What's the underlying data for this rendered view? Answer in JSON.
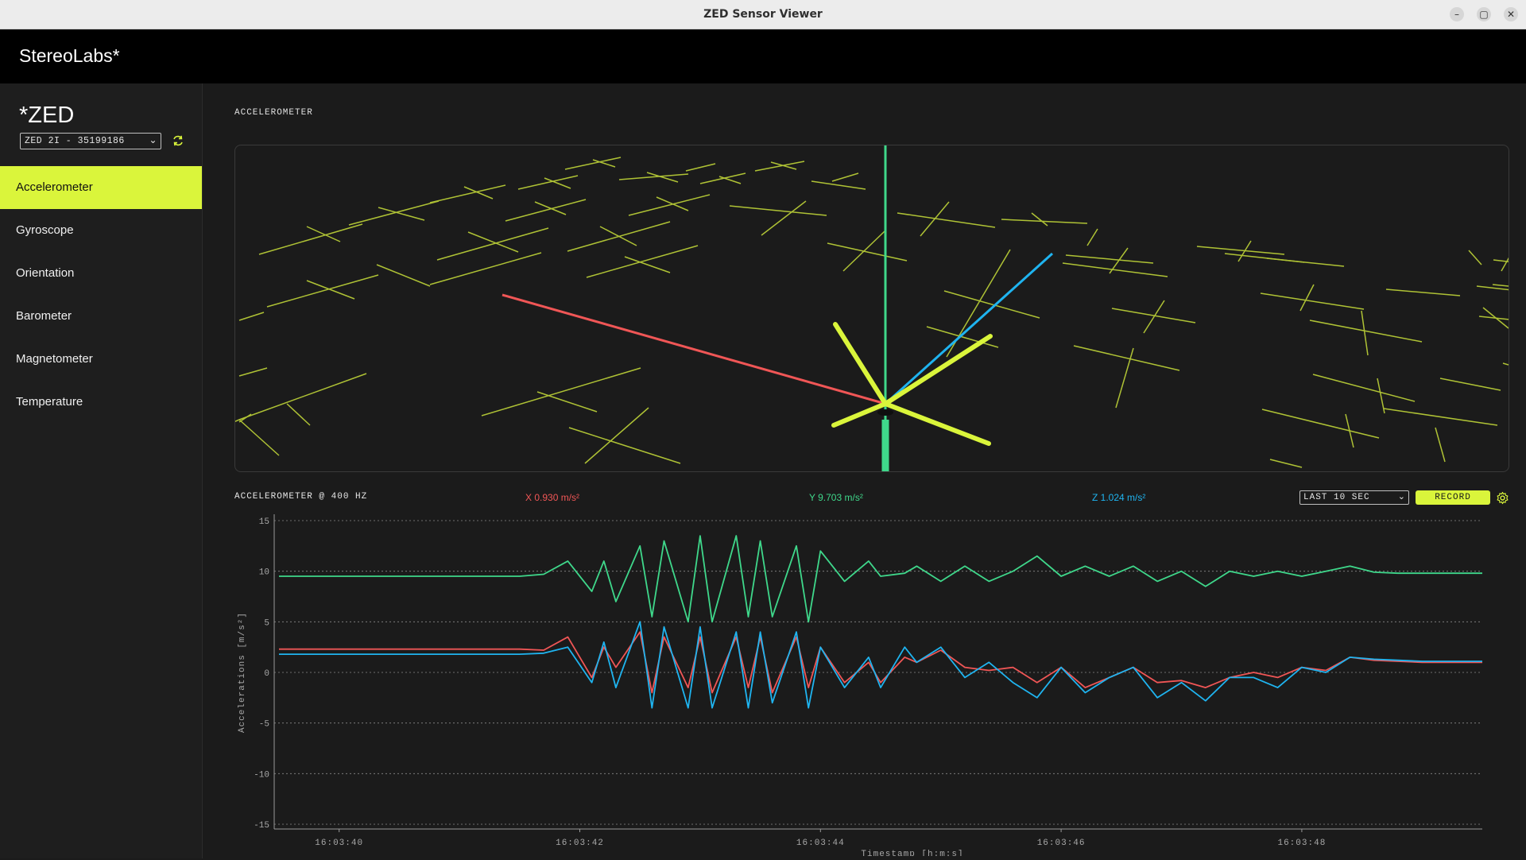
{
  "window": {
    "title": "ZED Sensor Viewer",
    "controls": [
      "–",
      "▢",
      "✕"
    ]
  },
  "app": {
    "brand": "StereoLabs*"
  },
  "sidebar": {
    "title": "*ZED",
    "device": "ZED 2I - 35199186",
    "items": [
      {
        "label": "Accelerometer",
        "active": true
      },
      {
        "label": "Gyroscope"
      },
      {
        "label": "Orientation"
      },
      {
        "label": "Barometer"
      },
      {
        "label": "Magnetometer"
      },
      {
        "label": "Temperature"
      }
    ]
  },
  "main": {
    "section_label": "ACCELEROMETER",
    "chart_header": {
      "title": "ACCELEROMETER @  400 HZ",
      "x_readout": "X 0.930 m/s²",
      "y_readout": "Y 9.703 m/s²",
      "z_readout": "Z 1.024 m/s²",
      "range": "LAST 10 SEC",
      "record": "RECORD"
    }
  },
  "colors": {
    "accent": "#daf53b",
    "x": "#f05656",
    "y": "#3fd88b",
    "z": "#1fb4f0"
  },
  "chart_data": {
    "type": "line",
    "xlabel": "Timestamp [h:m:s]",
    "ylabel": "Accelerations [m/s²]",
    "ylim": [
      -15,
      15
    ],
    "yticks": [
      15,
      10,
      5,
      0,
      -5,
      -10,
      -15
    ],
    "xlim": [
      "16:03:39.5",
      "16:03:49.5"
    ],
    "xticks": [
      "16:03:40",
      "16:03:42",
      "16:03:44",
      "16:03:46",
      "16:03:48"
    ],
    "grid": true,
    "x": [
      "16:03:39.5",
      "16:03:40.0",
      "16:03:40.5",
      "16:03:41.0",
      "16:03:41.5",
      "16:03:41.7",
      "16:03:41.9",
      "16:03:42.1",
      "16:03:42.2",
      "16:03:42.3",
      "16:03:42.5",
      "16:03:42.6",
      "16:03:42.7",
      "16:03:42.9",
      "16:03:43.0",
      "16:03:43.1",
      "16:03:43.3",
      "16:03:43.4",
      "16:03:43.5",
      "16:03:43.6",
      "16:03:43.8",
      "16:03:43.9",
      "16:03:44.0",
      "16:03:44.2",
      "16:03:44.4",
      "16:03:44.5",
      "16:03:44.7",
      "16:03:44.8",
      "16:03:45.0",
      "16:03:45.2",
      "16:03:45.4",
      "16:03:45.6",
      "16:03:45.8",
      "16:03:46.0",
      "16:03:46.2",
      "16:03:46.4",
      "16:03:46.6",
      "16:03:46.8",
      "16:03:47.0",
      "16:03:47.2",
      "16:03:47.4",
      "16:03:47.6",
      "16:03:47.8",
      "16:03:48.0",
      "16:03:48.2",
      "16:03:48.4",
      "16:03:48.6",
      "16:03:48.8",
      "16:03:49.0",
      "16:03:49.5"
    ],
    "series": [
      {
        "name": "X",
        "values": [
          2.3,
          2.3,
          2.3,
          2.3,
          2.3,
          2.2,
          3.5,
          -0.5,
          2.5,
          0.5,
          4.0,
          -2.0,
          3.5,
          -1.5,
          3.5,
          -2.0,
          3.5,
          -1.5,
          3.5,
          -2.0,
          3.5,
          -1.5,
          2.5,
          -1.0,
          1.0,
          -1.0,
          1.5,
          1.0,
          2.2,
          0.5,
          0.2,
          0.5,
          -1.0,
          0.5,
          -1.5,
          -0.5,
          0.5,
          -1.0,
          -0.8,
          -1.5,
          -0.5,
          0.0,
          -0.5,
          0.5,
          0.2,
          1.5,
          1.2,
          1.1,
          1.0,
          1.0
        ]
      },
      {
        "name": "Y",
        "values": [
          9.5,
          9.5,
          9.5,
          9.5,
          9.5,
          9.7,
          11.0,
          8.0,
          11.0,
          7.0,
          12.5,
          5.5,
          13.0,
          5.0,
          13.5,
          5.0,
          13.5,
          5.5,
          13.0,
          5.5,
          12.5,
          5.0,
          12.0,
          9.0,
          11.0,
          9.5,
          9.8,
          10.5,
          9.0,
          10.5,
          9.0,
          10.0,
          11.5,
          9.5,
          10.5,
          9.5,
          10.5,
          9.0,
          10.0,
          8.5,
          10.0,
          9.5,
          10.0,
          9.5,
          10.0,
          10.5,
          9.9,
          9.8,
          9.8,
          9.8
        ]
      },
      {
        "name": "Z",
        "values": [
          1.8,
          1.8,
          1.8,
          1.8,
          1.8,
          1.9,
          2.5,
          -1.0,
          3.0,
          -1.5,
          5.0,
          -3.5,
          4.5,
          -3.5,
          4.5,
          -3.5,
          4.0,
          -3.5,
          4.0,
          -3.0,
          4.0,
          -3.5,
          2.5,
          -1.5,
          1.5,
          -1.5,
          2.5,
          1.0,
          2.5,
          -0.5,
          1.0,
          -1.0,
          -2.5,
          0.5,
          -2.0,
          -0.5,
          0.5,
          -2.5,
          -1.0,
          -2.8,
          -0.5,
          -0.5,
          -1.5,
          0.5,
          0.0,
          1.5,
          1.3,
          1.2,
          1.1,
          1.1
        ]
      }
    ]
  }
}
